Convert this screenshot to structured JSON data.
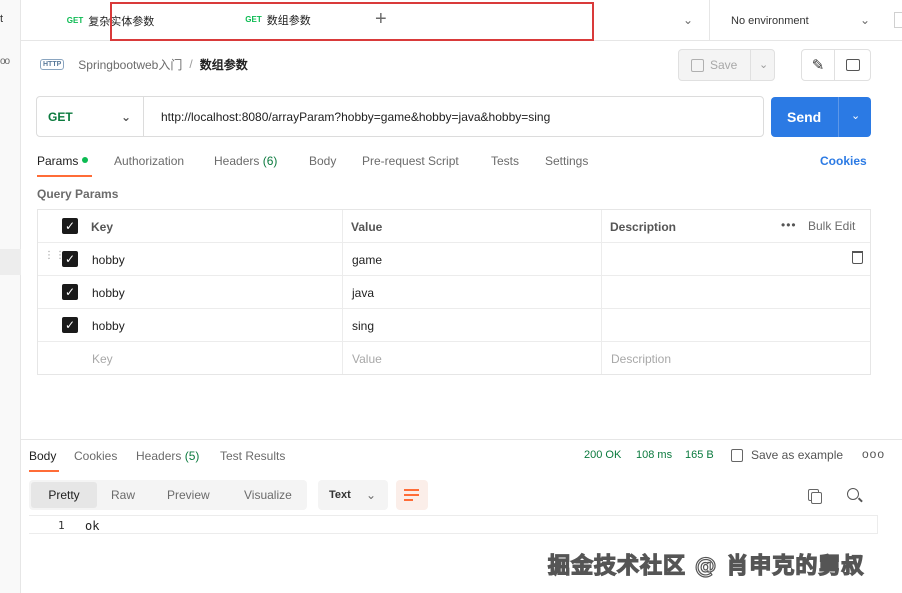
{
  "sidebar": {
    "fragment": "t",
    "dots": "oo"
  },
  "tabs": [
    {
      "method": "GET",
      "label": "复杂实体参数"
    },
    {
      "method": "GET",
      "label": "数组参数"
    }
  ],
  "environment": {
    "label": "No environment"
  },
  "breadcrumb": {
    "protocol_icon": "HTTP",
    "parent": "Springbootweb入门",
    "separator": "/",
    "current": "数组参数"
  },
  "toolbar": {
    "save_label": "Save"
  },
  "request": {
    "method": "GET",
    "url": "http://localhost:8080/arrayParam?hobby=game&hobby=java&hobby=sing",
    "send_label": "Send"
  },
  "request_tabs": [
    {
      "label": "Params",
      "active": true
    },
    {
      "label": "Authorization"
    },
    {
      "label": "Headers ",
      "count": "(6)"
    },
    {
      "label": "Body"
    },
    {
      "label": "Pre-request Script"
    },
    {
      "label": "Tests"
    },
    {
      "label": "Settings"
    }
  ],
  "cookies_label": "Cookies",
  "query_params": {
    "title": "Query Params",
    "headers": {
      "key": "Key",
      "value": "Value",
      "description": "Description",
      "bulk_edit": "Bulk Edit"
    },
    "rows": [
      {
        "key": "hobby",
        "value": "game",
        "description": "",
        "checked": true
      },
      {
        "key": "hobby",
        "value": "java",
        "description": "",
        "checked": true
      },
      {
        "key": "hobby",
        "value": "sing",
        "description": "",
        "checked": true
      }
    ],
    "placeholders": {
      "key": "Key",
      "value": "Value",
      "description": "Description"
    }
  },
  "response": {
    "tabs": [
      {
        "label": "Body",
        "active": true
      },
      {
        "label": "Cookies"
      },
      {
        "label": "Headers ",
        "count": "(5)"
      },
      {
        "label": "Test Results"
      }
    ],
    "status": "200 OK",
    "time": "108 ms",
    "size": "165 B",
    "save_example": "Save as example",
    "formats": [
      "Pretty",
      "Raw",
      "Preview",
      "Visualize"
    ],
    "type": "Text",
    "lines": [
      {
        "num": "1",
        "text": "ok"
      }
    ]
  },
  "watermark": "掘金技术社区 @ 肖申克的舅叔",
  "colors": {
    "accent": "#ff6c37",
    "send": "#2b7ae4",
    "get": "#0b7a3e",
    "highlight": "#d93a3a"
  }
}
